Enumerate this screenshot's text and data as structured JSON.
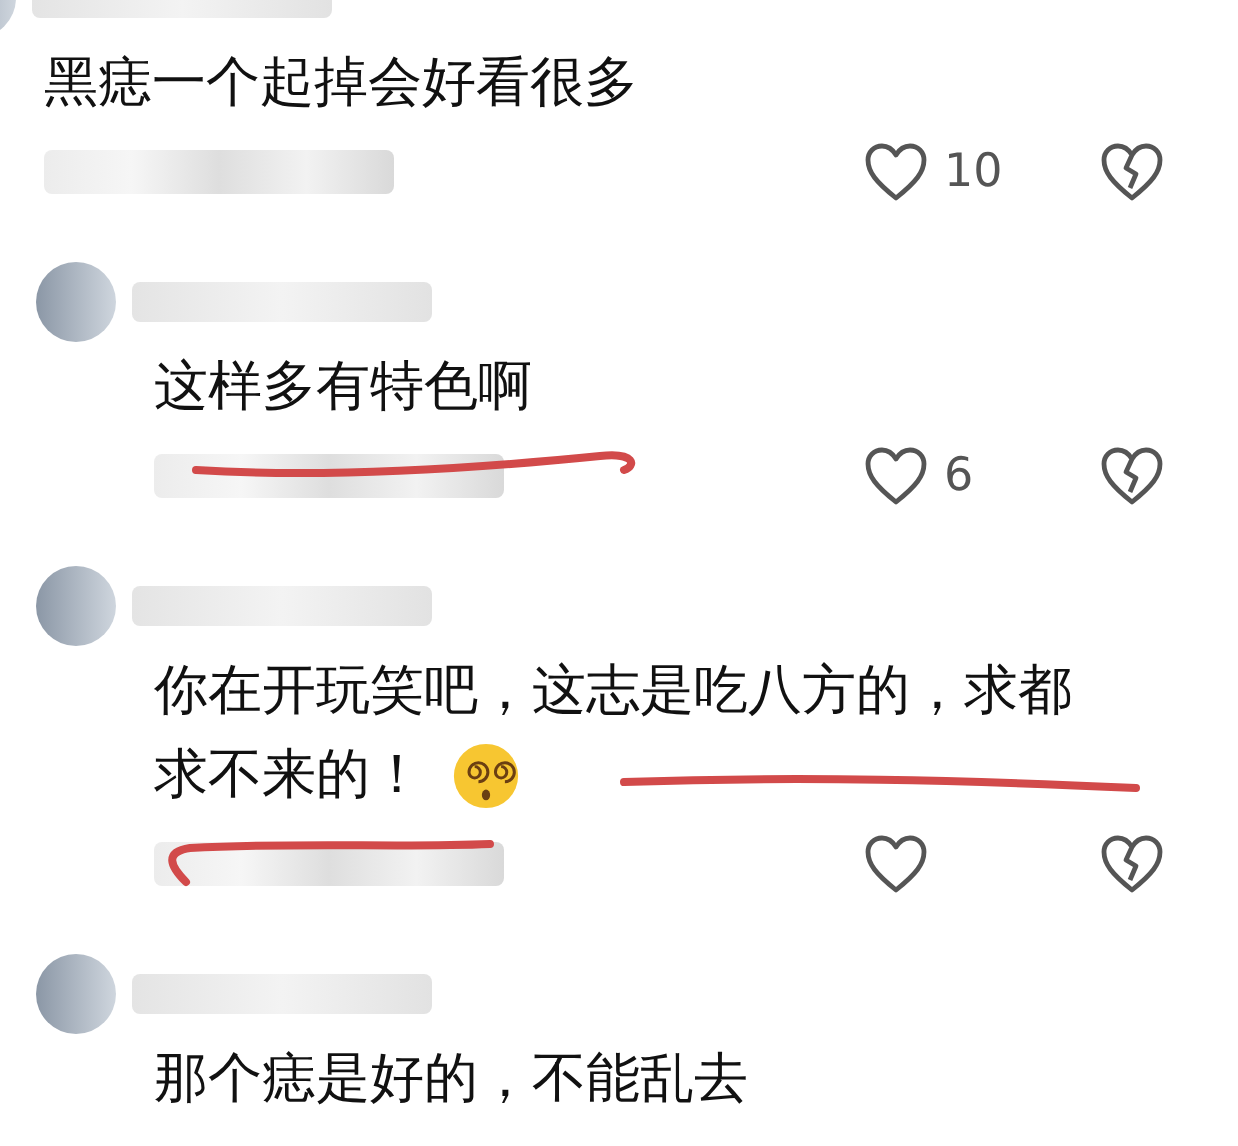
{
  "comments": [
    {
      "kind": "top",
      "lines": [
        "黑痣一个起掉会好看很多"
      ],
      "likes": "10",
      "emoji": false,
      "marked_text": false,
      "marked_meta": false
    },
    {
      "kind": "reply",
      "lines": [
        "这样多有特色啊"
      ],
      "likes": "6",
      "emoji": false,
      "marked_text": false,
      "marked_meta": true
    },
    {
      "kind": "reply",
      "lines": [
        "你在开玩笑吧，这志是吃八方的，求都",
        "求不来的！"
      ],
      "emoji": true,
      "marked_text": true,
      "marked_meta": true
    },
    {
      "kind": "reply",
      "lines": [
        "那个痣是好的，不能乱去"
      ],
      "emoji": false,
      "marked_text": false,
      "meta_visible": false
    }
  ]
}
